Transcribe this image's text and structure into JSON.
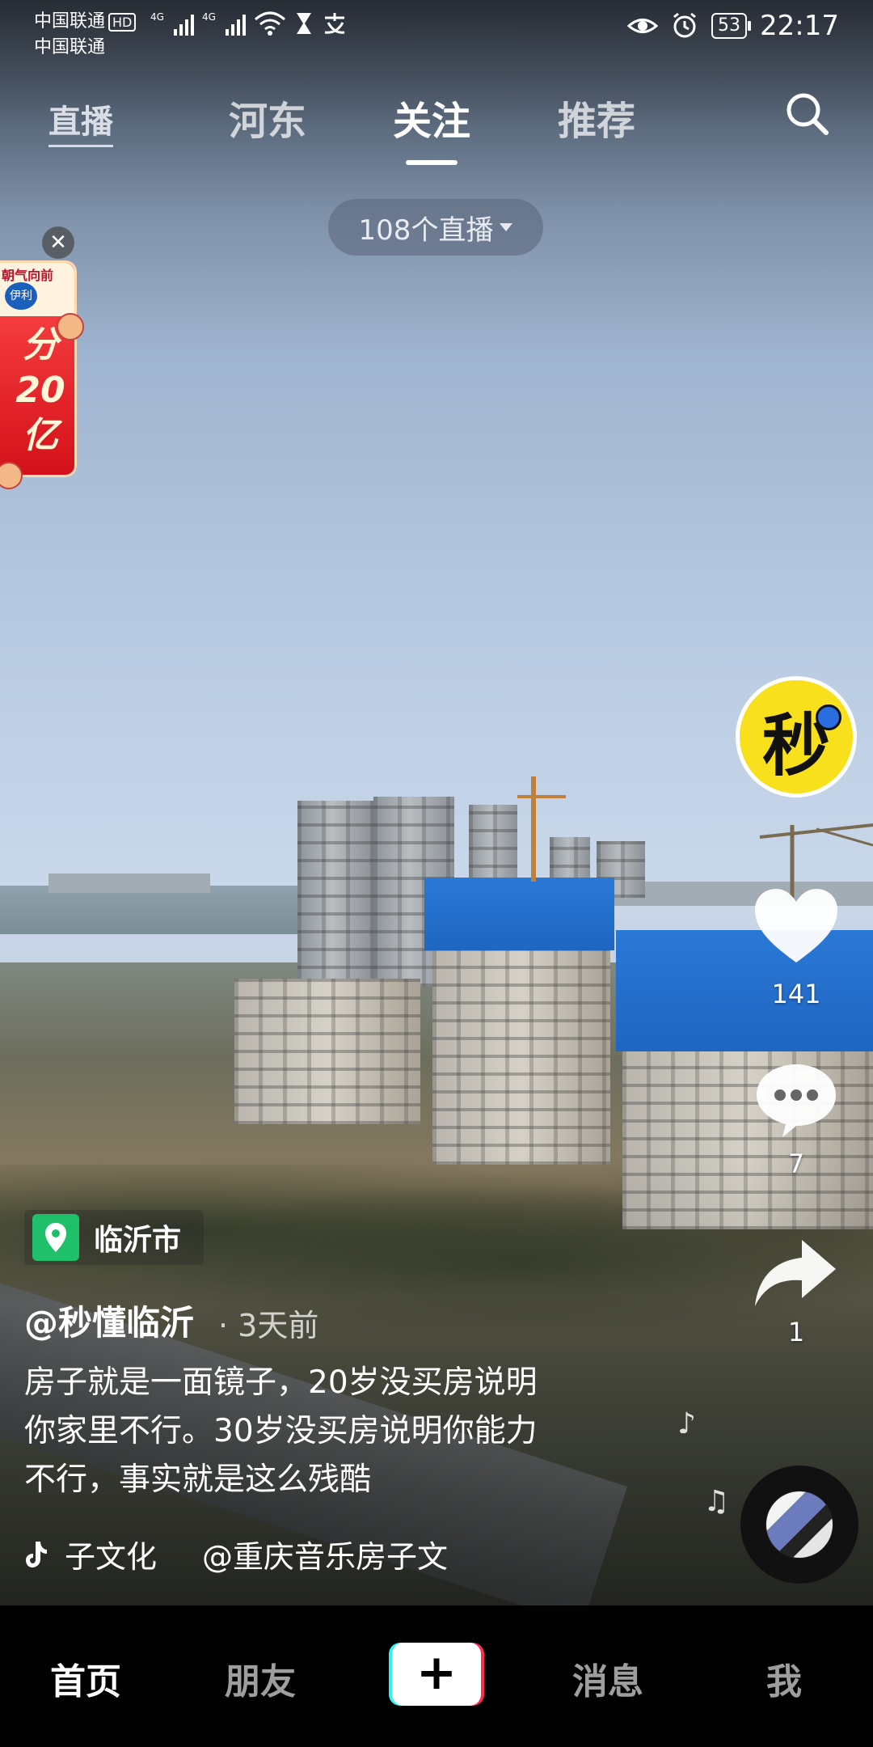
{
  "status_bar": {
    "carrier_top": "中国联通",
    "hd_badge": "HD",
    "carrier_bottom": "中国联通",
    "network_1": "4G",
    "network_2": "4G",
    "battery": "53",
    "time": "22:17"
  },
  "top_nav": {
    "live_label": "直播",
    "tabs": [
      "河东",
      "关注",
      "推荐"
    ],
    "active_tab": "关注"
  },
  "live_pill": {
    "label": "108个直播"
  },
  "ad": {
    "top_text": "朝气向前",
    "brand": "伊利",
    "main_text": "分20亿"
  },
  "rail": {
    "avatar_text": "秒",
    "likes": "141",
    "comments": "7",
    "shares": "1"
  },
  "video": {
    "location": "临沂市",
    "author": "@秒懂临沂",
    "time_ago": "· 3天前",
    "caption_lines": [
      "房子就是一面镜子，20岁没买房说明",
      "你家里不行。30岁没买房说明你能力",
      "不行，事实就是这么残酷"
    ],
    "music_left": "子文化",
    "music_right": "@重庆音乐房子文"
  },
  "bottom_nav": {
    "home": "首页",
    "friends": "朋友",
    "messages": "消息",
    "me": "我"
  },
  "colors": {
    "like_white": "#ffffff",
    "location_green": "#1ec06a",
    "avatar_yellow": "#f8e01c",
    "plus_cyan": "#35f0f0",
    "plus_red": "#fe2c55"
  }
}
